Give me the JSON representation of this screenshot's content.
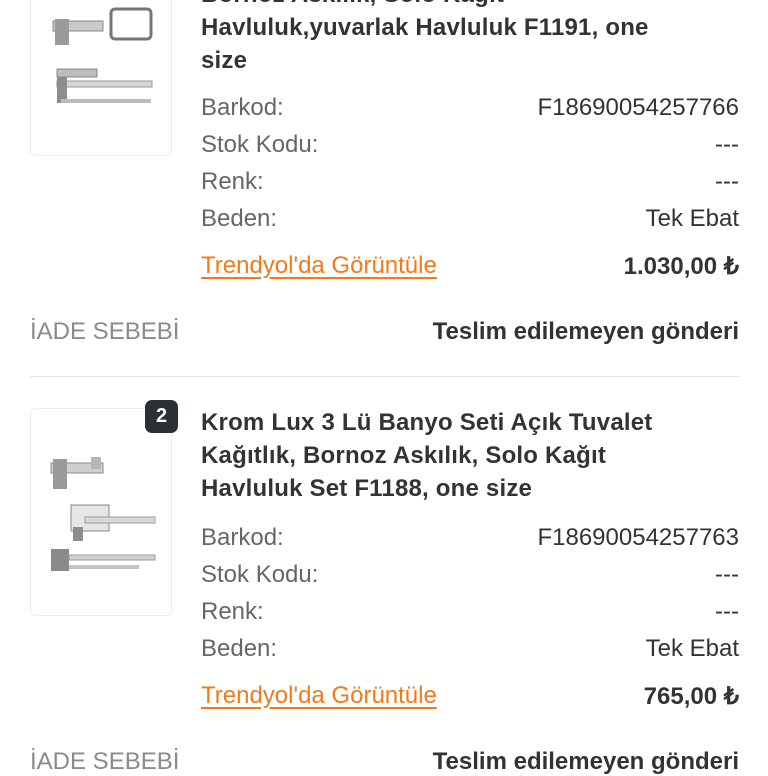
{
  "items": [
    {
      "title_lines": [
        "Bornoz Askılık, Solo Kağıt",
        "Havluluk,yuvarlak Havluluk F1191, one",
        "size"
      ],
      "fields": [
        {
          "label": "Barkod:",
          "value": "F18690054257766"
        },
        {
          "label": "Stok Kodu:",
          "value": "---"
        },
        {
          "label": "Renk:",
          "value": "---"
        },
        {
          "label": "Beden:",
          "value": "Tek Ebat"
        }
      ],
      "link_label": "Trendyol'da Görüntüle",
      "price": "1.030,00 ₺",
      "return_reason_label": "İADE SEBEBİ",
      "return_reason_value": "Teslim edilemeyen gönderi"
    },
    {
      "badge": "2",
      "title_lines": [
        "Krom Lux 3 Lü Banyo Seti Açık Tuvalet",
        "Kağıtlık, Bornoz Askılık, Solo Kağıt",
        "Havluluk Set F1188, one size"
      ],
      "fields": [
        {
          "label": "Barkod:",
          "value": "F18690054257763"
        },
        {
          "label": "Stok Kodu:",
          "value": "---"
        },
        {
          "label": "Renk:",
          "value": "---"
        },
        {
          "label": "Beden:",
          "value": "Tek Ebat"
        }
      ],
      "link_label": "Trendyol'da Görüntüle",
      "price": "765,00 ₺",
      "return_reason_label": "İADE SEBEBİ",
      "return_reason_value": "Teslim edilemeyen gönderi"
    }
  ]
}
